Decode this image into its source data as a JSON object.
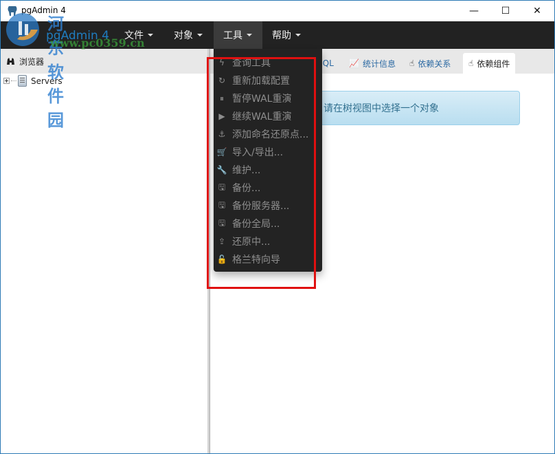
{
  "window": {
    "title": "pgAdmin 4",
    "controls": {
      "minimize": "—",
      "maximize": "☐",
      "close": "✕"
    }
  },
  "watermark": {
    "text": "河东软件园",
    "url": "www.pc0359.cn"
  },
  "navbar": {
    "brand": "pgAdmin 4",
    "menus": [
      {
        "label": "文件"
      },
      {
        "label": "对象"
      },
      {
        "label": "工具",
        "active": true
      },
      {
        "label": "帮助"
      }
    ]
  },
  "left_panel": {
    "title": "浏览器",
    "icon": "binoculars-icon",
    "tree": [
      {
        "label": "Servers",
        "icon": "server-group-icon",
        "expanded": false
      }
    ]
  },
  "right_panel": {
    "tabs": [
      {
        "label": "SQL",
        "icon": ""
      },
      {
        "label": "统计信息",
        "icon": "line-chart-icon"
      },
      {
        "label": "依赖关系",
        "icon": "hand-pointer-icon"
      },
      {
        "label": "依赖组件",
        "icon": "hand-pointer-icon",
        "active": true
      }
    ],
    "message": "请在树视图中选择一个对象"
  },
  "tools_menu": {
    "items": [
      {
        "label": "查询工具",
        "icon": "bolt-icon",
        "glyph": "ϟ"
      },
      {
        "label": "重新加载配置",
        "icon": "refresh-icon",
        "glyph": "↻"
      },
      {
        "label": "暂停WAL重演",
        "icon": "pause-circle-icon",
        "glyph": "⏸"
      },
      {
        "label": "继续WAL重演",
        "icon": "play-circle-icon",
        "glyph": "▶"
      },
      {
        "label": "添加命名还原点...",
        "icon": "anchor-icon",
        "glyph": "⚓"
      },
      {
        "label": "导入/导出...",
        "icon": "shopping-cart-icon",
        "glyph": "🛒"
      },
      {
        "label": "维护...",
        "icon": "wrench-icon",
        "glyph": "🔧"
      },
      {
        "label": "备份...",
        "icon": "floppy-icon",
        "glyph": "🖫"
      },
      {
        "label": "备份服务器...",
        "icon": "floppy-icon",
        "glyph": "🖫"
      },
      {
        "label": "备份全局...",
        "icon": "floppy-icon",
        "glyph": "🖫"
      },
      {
        "label": "还原中...",
        "icon": "upload-icon",
        "glyph": "⇪"
      },
      {
        "label": "格兰特向导",
        "icon": "unlock-icon",
        "glyph": "🔓"
      }
    ]
  },
  "colors": {
    "navbar_bg": "#222222",
    "menu_bg": "#232323",
    "menu_text_disabled": "#8e8e8e",
    "highlight_box": "#e01010",
    "alert_text": "#31708f",
    "tab_link": "#2c6aa3"
  }
}
